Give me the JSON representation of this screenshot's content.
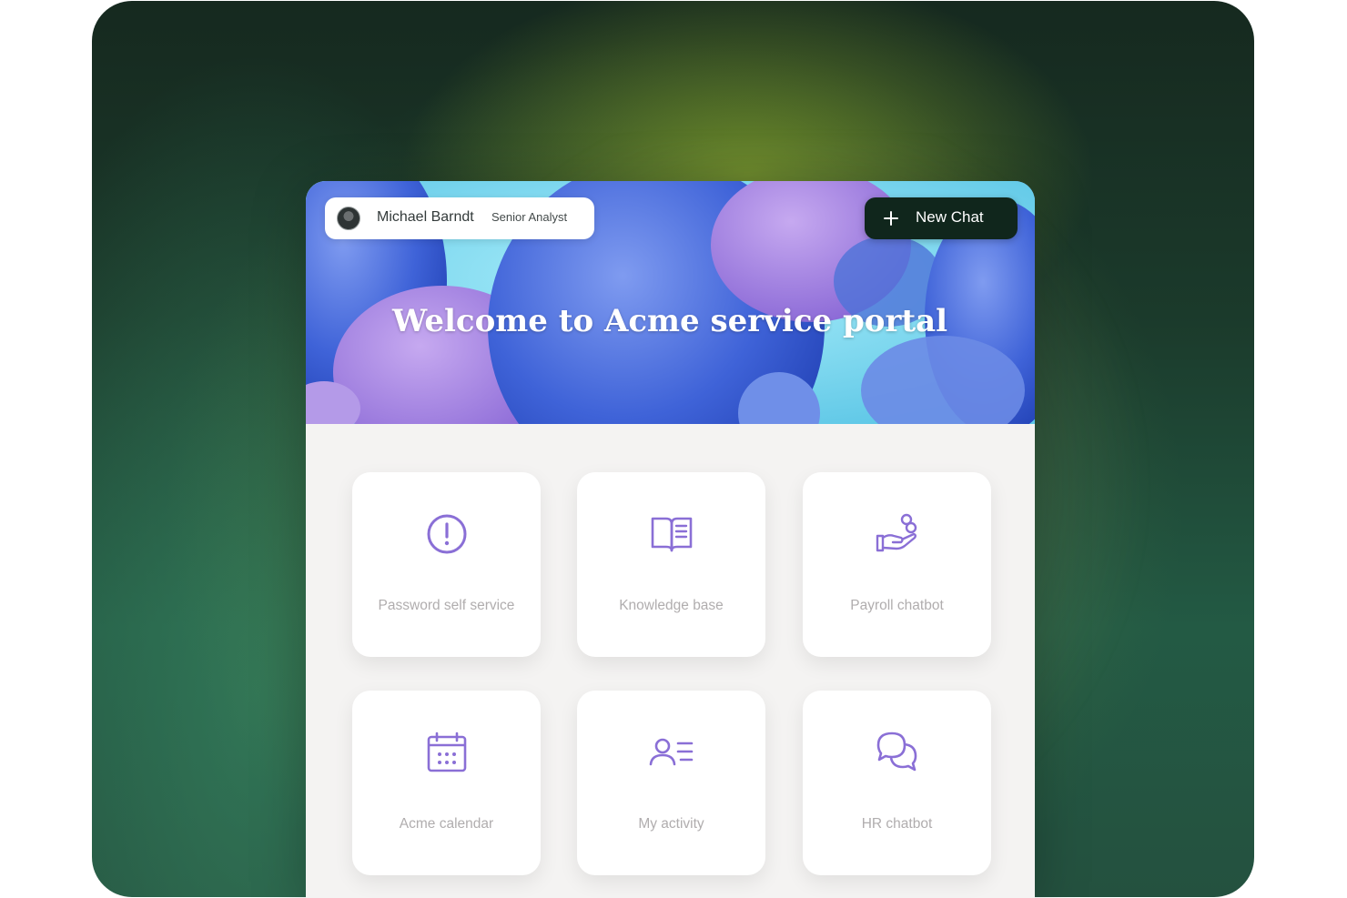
{
  "header": {
    "user_name": "Michael Barndt",
    "user_role": "Senior Analyst",
    "new_chat_label": "New Chat"
  },
  "hero": {
    "title": "Welcome to Acme service portal"
  },
  "tiles": [
    {
      "label": "Password self service",
      "icon": "alert-circle-icon"
    },
    {
      "label": "Knowledge base",
      "icon": "book-icon"
    },
    {
      "label": "Payroll chatbot",
      "icon": "hand-coins-icon"
    },
    {
      "label": "Acme calendar",
      "icon": "calendar-icon"
    },
    {
      "label": "My activity",
      "icon": "user-list-icon"
    },
    {
      "label": "HR chatbot",
      "icon": "chat-bubbles-icon"
    }
  ],
  "colors": {
    "accent": "#8a6fd6",
    "new_chat_bg": "#10261c",
    "tile_label": "#b0adae",
    "panel_bg": "#f4f3f2"
  }
}
